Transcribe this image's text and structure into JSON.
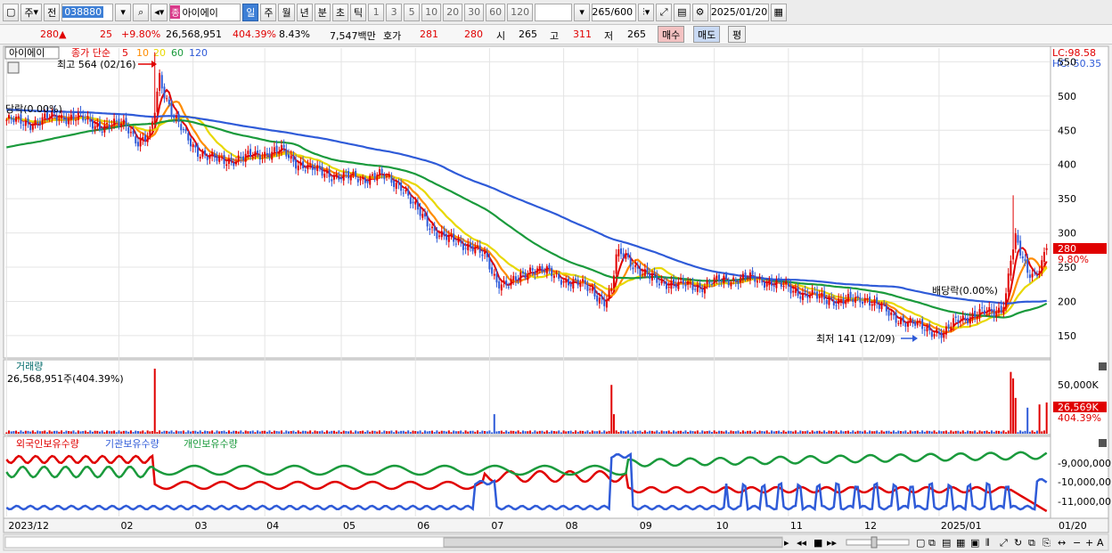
{
  "toolbar": {
    "market": "주",
    "prev": "전",
    "code": "038880",
    "name": "아이에이",
    "name_badge": "종",
    "periods": [
      "일",
      "주",
      "월",
      "년",
      "분",
      "초",
      "틱"
    ],
    "selected_period": "일",
    "intervals": [
      "1",
      "3",
      "5",
      "10",
      "20",
      "30",
      "60",
      "120"
    ],
    "count": "265",
    "count_total": "/600",
    "date": "2025/01/20"
  },
  "quote": {
    "price": "280",
    "arrow": "▲",
    "change": "25",
    "change_pct": "+9.80%",
    "volume": "26,568,951",
    "volume_pct": "404.39%",
    "turnover_pct": "8.43%",
    "amount": "7,547백만",
    "bid_label": "호가",
    "bid": "281",
    "ask": "280",
    "open_label": "시",
    "open": "265",
    "high_label": "고",
    "high": "311",
    "low_label": "저",
    "low": "265",
    "buy_label": "매수",
    "sell_label": "매도",
    "eval_label": "평"
  },
  "price_panel": {
    "stock_label": "아이에이",
    "ma_legend_prefix": "종가 단순",
    "ma_periods": [
      "5",
      "10",
      "20",
      "60",
      "120"
    ],
    "ma_colors": [
      "#e00000",
      "#ff8c00",
      "#e8d800",
      "#1a9a3c",
      "#2f5bd8"
    ],
    "lc": "LC:98.58",
    "hc": "HC:-50.35",
    "high_note": "최고 564 (02/16)",
    "low_note": "최저 141 (12/09)",
    "ex_left": "당락(0.00%)",
    "ex_right": "배당락(0.00%)",
    "current_price": "280",
    "current_pct": "9.80%",
    "y_ticks": [
      "550",
      "500",
      "450",
      "400",
      "350",
      "300",
      "250",
      "200",
      "150"
    ]
  },
  "volume_panel": {
    "title": "거래량",
    "info": "26,568,951주(404.39%)",
    "tick": "50,000K",
    "current": "26,569K",
    "current_pct": "404.39%"
  },
  "holding_panel": {
    "legend": [
      "외국인보유수량",
      "기관보유수량",
      "개인보유수량"
    ],
    "legend_colors": [
      "#e00000",
      "#2f5bd8",
      "#1a9a3c"
    ],
    "ticks": [
      "-9,000,000",
      "-10,000,00",
      "-11,000,00"
    ]
  },
  "x_axis": {
    "labels": [
      "2023/12",
      "02",
      "03",
      "04",
      "05",
      "06",
      "07",
      "08",
      "09",
      "10",
      "11",
      "12",
      "2025/01"
    ],
    "right_label": "01/20"
  },
  "chart_data": {
    "type": "candlestick",
    "x_labels": [
      "2023/12",
      "02",
      "03",
      "04",
      "05",
      "06",
      "07",
      "08",
      "09",
      "10",
      "11",
      "12",
      "2025/01"
    ],
    "price_range": [
      120,
      570
    ],
    "high": {
      "value": 564,
      "date": "02/16"
    },
    "low": {
      "value": 141,
      "date": "12/09"
    },
    "close_anchors": [
      [
        0,
        465
      ],
      [
        10,
        460
      ],
      [
        20,
        470
      ],
      [
        30,
        468
      ],
      [
        40,
        455
      ],
      [
        50,
        460
      ],
      [
        55,
        432
      ],
      [
        60,
        440
      ],
      [
        62,
        480
      ],
      [
        64,
        530
      ],
      [
        66,
        505
      ],
      [
        70,
        470
      ],
      [
        75,
        440
      ],
      [
        80,
        420
      ],
      [
        85,
        410
      ],
      [
        90,
        405
      ],
      [
        100,
        410
      ],
      [
        110,
        418
      ],
      [
        115,
        420
      ],
      [
        120,
        405
      ],
      [
        130,
        390
      ],
      [
        140,
        382
      ],
      [
        150,
        380
      ],
      [
        155,
        385
      ],
      [
        160,
        378
      ],
      [
        165,
        370
      ],
      [
        170,
        340
      ],
      [
        175,
        320
      ],
      [
        180,
        300
      ],
      [
        185,
        290
      ],
      [
        190,
        285
      ],
      [
        195,
        280
      ],
      [
        198,
        270
      ],
      [
        200,
        265
      ],
      [
        205,
        230
      ],
      [
        210,
        225
      ],
      [
        215,
        235
      ],
      [
        220,
        250
      ],
      [
        225,
        245
      ],
      [
        230,
        235
      ],
      [
        235,
        230
      ],
      [
        240,
        225
      ],
      [
        245,
        215
      ],
      [
        250,
        200
      ],
      [
        253,
        215
      ],
      [
        255,
        265
      ],
      [
        258,
        270
      ],
      [
        262,
        255
      ],
      [
        266,
        240
      ],
      [
        272,
        230
      ],
      [
        280,
        225
      ],
      [
        290,
        222
      ],
      [
        300,
        232
      ],
      [
        310,
        234
      ],
      [
        320,
        228
      ],
      [
        330,
        215
      ],
      [
        340,
        205
      ],
      [
        350,
        200
      ],
      [
        360,
        205
      ],
      [
        365,
        192
      ],
      [
        370,
        180
      ],
      [
        375,
        172
      ],
      [
        380,
        166
      ],
      [
        385,
        160
      ],
      [
        390,
        155
      ],
      [
        392,
        150
      ],
      [
        394,
        160
      ],
      [
        398,
        175
      ],
      [
        405,
        180
      ],
      [
        412,
        185
      ],
      [
        416,
        190
      ],
      [
        418,
        210
      ],
      [
        420,
        262
      ],
      [
        422,
        290
      ],
      [
        424,
        270
      ],
      [
        427,
        245
      ],
      [
        430,
        240
      ],
      [
        433,
        255
      ],
      [
        435,
        280
      ]
    ],
    "ma_values_end": {
      "ma5": 250,
      "ma20": 228,
      "ma60": 195,
      "ma120": 212
    }
  }
}
